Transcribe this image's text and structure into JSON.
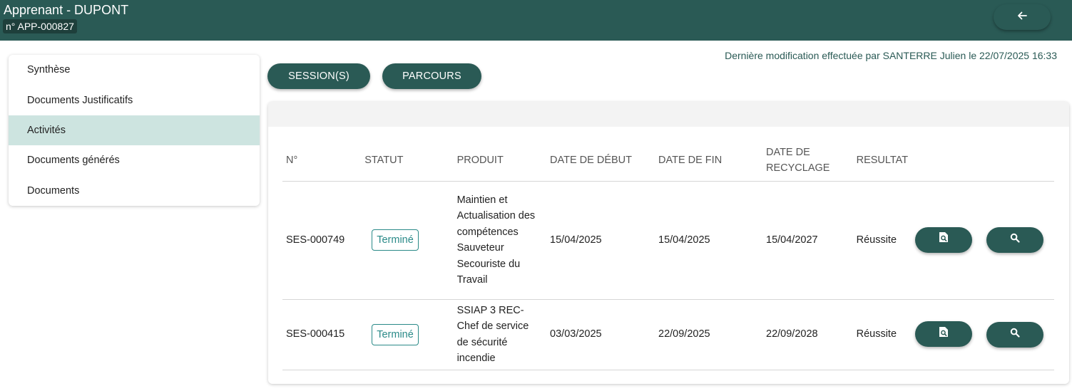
{
  "header": {
    "title": "Apprenant - DUPONT",
    "reference": "n° APP-000827",
    "back_icon": "arrow-left-icon"
  },
  "last_modification": "Dernière modification effectuée par SANTERRE Julien le 22/07/2025 16:33",
  "sidebar": {
    "items": [
      {
        "label": "Synthèse",
        "active": false
      },
      {
        "label": "Documents Justificatifs",
        "active": false
      },
      {
        "label": "Activités",
        "active": true
      },
      {
        "label": "Documents générés",
        "active": false
      },
      {
        "label": "Documents",
        "active": false
      }
    ]
  },
  "tabs": {
    "sessions": "SESSION(S)",
    "parcours": "PARCOURS"
  },
  "table": {
    "headers": {
      "num": "N°",
      "statut": "STATUT",
      "produit": "PRODUIT",
      "date_debut": "DATE DE DÉBUT",
      "date_fin": "DATE DE FIN",
      "date_recyclage": "DATE DE RECYCLAGE",
      "resultat": "RESULTAT"
    },
    "rows": [
      {
        "num": "SES-000749",
        "statut": "Terminé",
        "produit": "Maintien et Actualisation des compétences Sauveteur Secouriste du Travail",
        "date_debut": "15/04/2025",
        "date_fin": "15/04/2025",
        "date_recyclage": "15/04/2027",
        "resultat": "Réussite"
      },
      {
        "num": "SES-000415",
        "statut": "Terminé",
        "produit": "SSIAP 3 REC-Chef de service de sécurité incendie",
        "date_debut": "03/03/2025",
        "date_fin": "22/09/2025",
        "date_recyclage": "22/09/2028",
        "resultat": "Réussite"
      }
    ]
  },
  "colors": {
    "primary": "#2a5a55",
    "active_bg": "#cde4e0",
    "badge": "#2a8a88"
  }
}
